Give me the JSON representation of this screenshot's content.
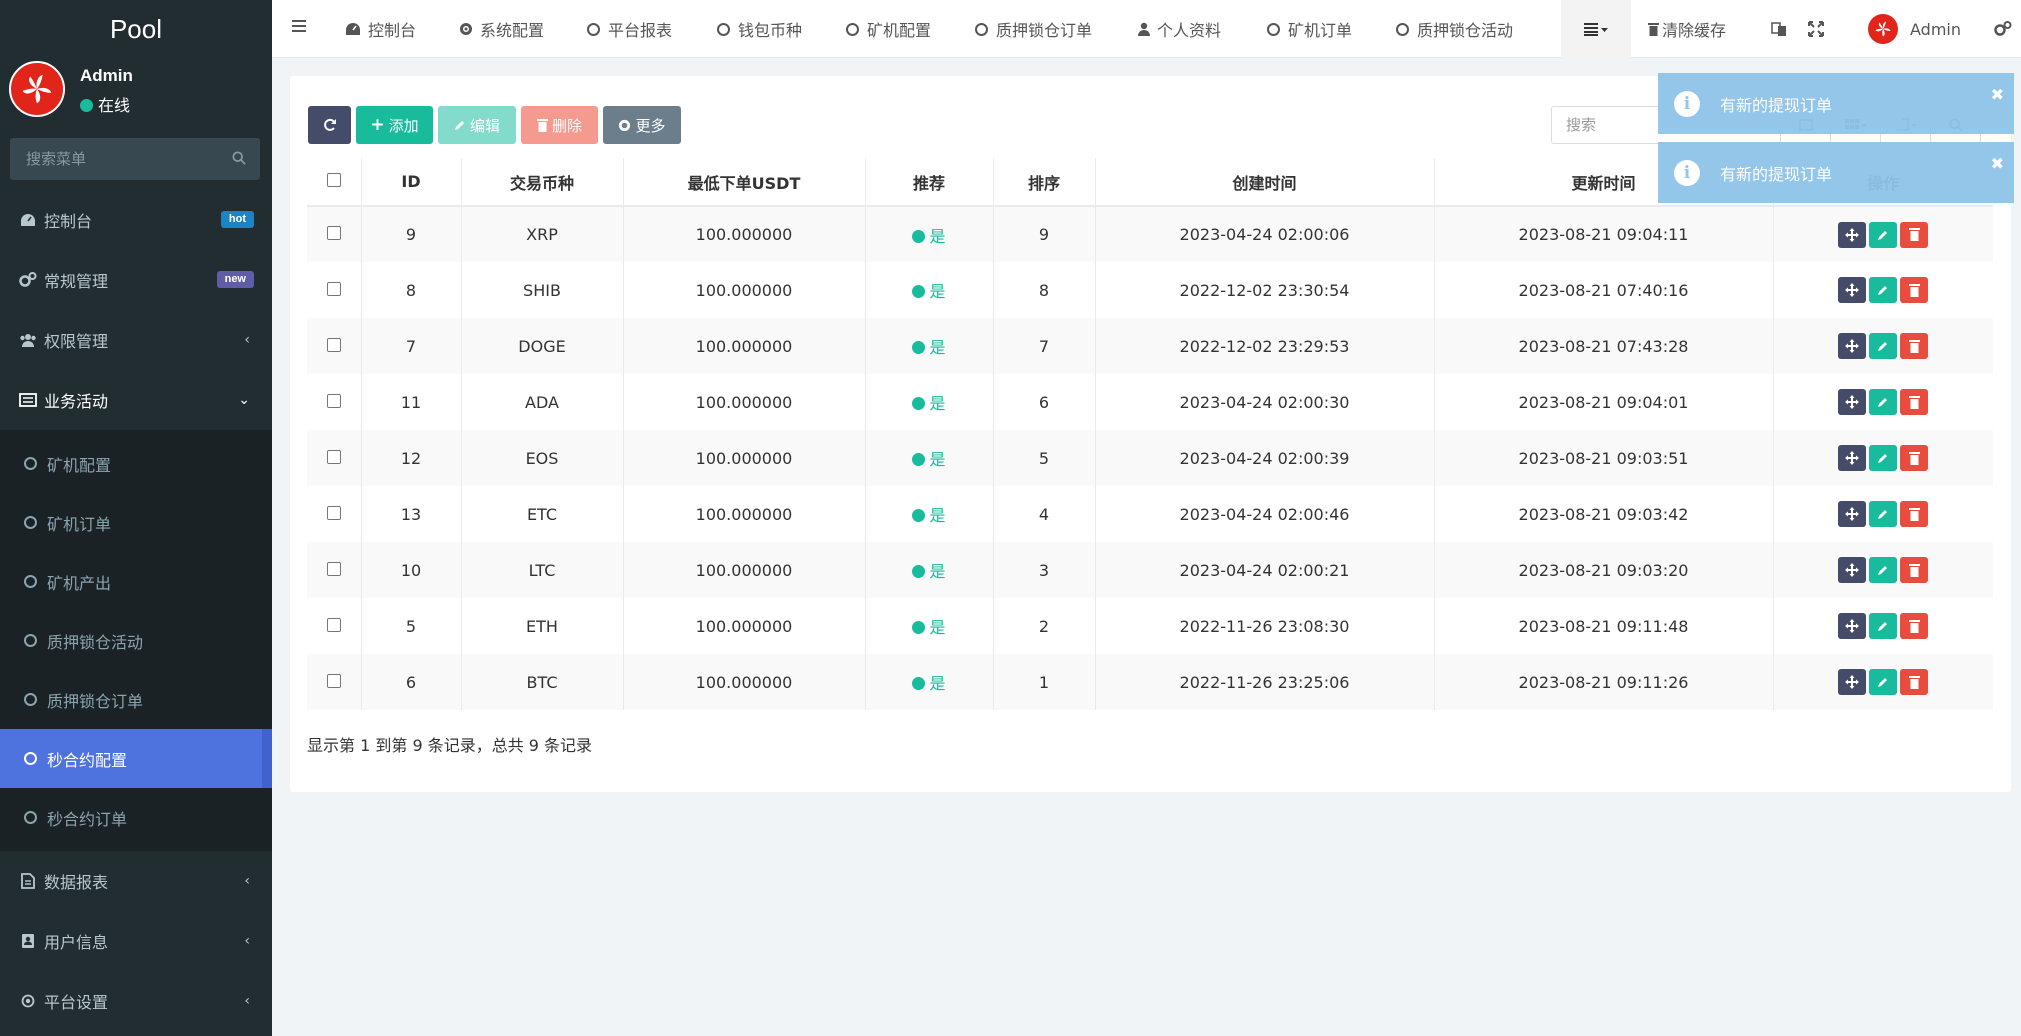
{
  "app": {
    "logo_text": "Pool"
  },
  "user": {
    "name": "Admin",
    "status": "在线"
  },
  "sidebar": {
    "search_placeholder": "搜索菜单",
    "items": [
      {
        "label": "控制台",
        "badge": "hot"
      },
      {
        "label": "常规管理",
        "badge": "new"
      },
      {
        "label": "权限管理"
      },
      {
        "label": "业务活动"
      },
      {
        "label": "数据报表"
      },
      {
        "label": "用户信息"
      },
      {
        "label": "平台设置"
      }
    ],
    "submenu": [
      {
        "label": "矿机配置"
      },
      {
        "label": "矿机订单"
      },
      {
        "label": "矿机产出"
      },
      {
        "label": "质押锁仓活动"
      },
      {
        "label": "质押锁仓订单"
      },
      {
        "label": "秒合约配置"
      },
      {
        "label": "秒合约订单"
      }
    ]
  },
  "topnav": {
    "tabs": [
      {
        "label": "控制台"
      },
      {
        "label": "系统配置"
      },
      {
        "label": "平台报表"
      },
      {
        "label": "钱包币种"
      },
      {
        "label": "矿机配置"
      },
      {
        "label": "质押锁仓订单"
      },
      {
        "label": "个人资料"
      },
      {
        "label": "矿机订单"
      },
      {
        "label": "质押锁仓活动"
      }
    ],
    "clear_cache": "清除缓存",
    "admin_name": "Admin"
  },
  "toolbar": {
    "add": "添加",
    "edit": "编辑",
    "delete": "删除",
    "more": "更多",
    "search_placeholder": "搜索"
  },
  "table": {
    "columns": [
      "ID",
      "交易币种",
      "最低下单USDT",
      "推荐",
      "排序",
      "创建时间",
      "更新时间",
      "操作"
    ],
    "rows": [
      {
        "id": "9",
        "coin": "XRP",
        "min": "100.000000",
        "rec": "是",
        "sort": "9",
        "created": "2023-04-24 02:00:06",
        "updated": "2023-08-21 09:04:11"
      },
      {
        "id": "8",
        "coin": "SHIB",
        "min": "100.000000",
        "rec": "是",
        "sort": "8",
        "created": "2022-12-02 23:30:54",
        "updated": "2023-08-21 07:40:16"
      },
      {
        "id": "7",
        "coin": "DOGE",
        "min": "100.000000",
        "rec": "是",
        "sort": "7",
        "created": "2022-12-02 23:29:53",
        "updated": "2023-08-21 07:43:28"
      },
      {
        "id": "11",
        "coin": "ADA",
        "min": "100.000000",
        "rec": "是",
        "sort": "6",
        "created": "2023-04-24 02:00:30",
        "updated": "2023-08-21 09:04:01"
      },
      {
        "id": "12",
        "coin": "EOS",
        "min": "100.000000",
        "rec": "是",
        "sort": "5",
        "created": "2023-04-24 02:00:39",
        "updated": "2023-08-21 09:03:51"
      },
      {
        "id": "13",
        "coin": "ETC",
        "min": "100.000000",
        "rec": "是",
        "sort": "4",
        "created": "2023-04-24 02:00:46",
        "updated": "2023-08-21 09:03:42"
      },
      {
        "id": "10",
        "coin": "LTC",
        "min": "100.000000",
        "rec": "是",
        "sort": "3",
        "created": "2023-04-24 02:00:21",
        "updated": "2023-08-21 09:03:20"
      },
      {
        "id": "5",
        "coin": "ETH",
        "min": "100.000000",
        "rec": "是",
        "sort": "2",
        "created": "2022-11-26 23:08:30",
        "updated": "2023-08-21 09:11:48"
      },
      {
        "id": "6",
        "coin": "BTC",
        "min": "100.000000",
        "rec": "是",
        "sort": "1",
        "created": "2022-11-26 23:25:06",
        "updated": "2023-08-21 09:11:26"
      }
    ]
  },
  "pagination": {
    "info": "显示第 1 到第 9 条记录，总共 9 条记录"
  },
  "toasts": [
    {
      "message": "有新的提现订单"
    },
    {
      "message": "有新的提现订单"
    }
  ],
  "colors": {
    "sidebar_bg": "#222d32",
    "active_item": "#4e73df",
    "success": "#18bc9c",
    "danger": "#e74c3c",
    "toast": "#8ec4e8"
  }
}
